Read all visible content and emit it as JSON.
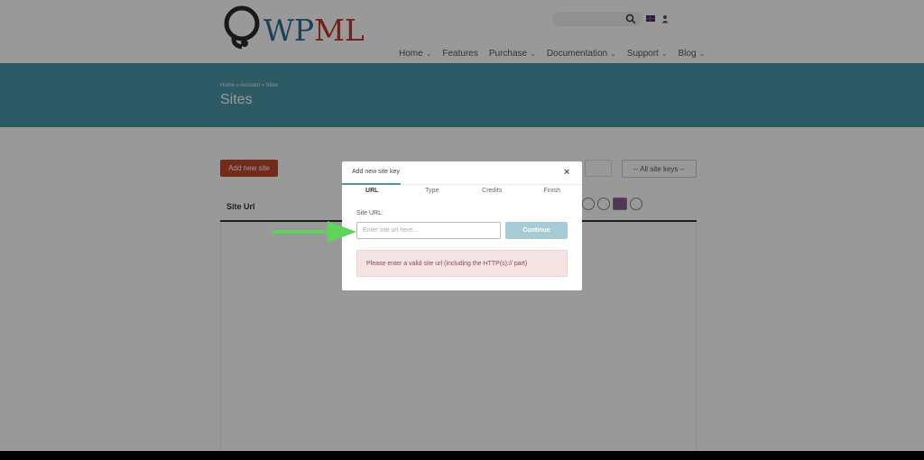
{
  "header": {
    "logo_text_wp": "WP",
    "logo_text_ml": "ML",
    "nav": [
      {
        "label": "Home",
        "chevron": true
      },
      {
        "label": "Features",
        "chevron": false
      },
      {
        "label": "Purchase",
        "chevron": true
      },
      {
        "label": "Documentation",
        "chevron": true
      },
      {
        "label": "Support",
        "chevron": true
      },
      {
        "label": "Blog",
        "chevron": true
      }
    ]
  },
  "banner": {
    "breadcrumb": "Home » Account » Sites",
    "title": "Sites"
  },
  "toolbar": {
    "add_new_site_label": "Add new site",
    "site_keys_select": "-- All site keys --"
  },
  "table": {
    "header_site_url": "Site Url"
  },
  "modal": {
    "title": "Add new site key",
    "close": "×",
    "steps": [
      "URL",
      "Type",
      "Credits",
      "Finish"
    ],
    "active_step": "URL",
    "site_url_label": "Site URL:",
    "url_placeholder": "Enter site url here...",
    "continue_label": "Continue",
    "error_message": "Please enter a valid site url (including the HTTP(s):// part)"
  },
  "colors": {
    "banner": "#4c98a8",
    "add_button": "#c04a2e",
    "continue_button": "#a6cbd6",
    "arrow": "#5fd35a",
    "error_bg": "#f6e3e3"
  },
  "icons": {
    "search": "search-icon",
    "flag": "uk-flag-icon",
    "user": "user-icon",
    "close": "close-icon",
    "arrow": "green-arrow-icon"
  }
}
